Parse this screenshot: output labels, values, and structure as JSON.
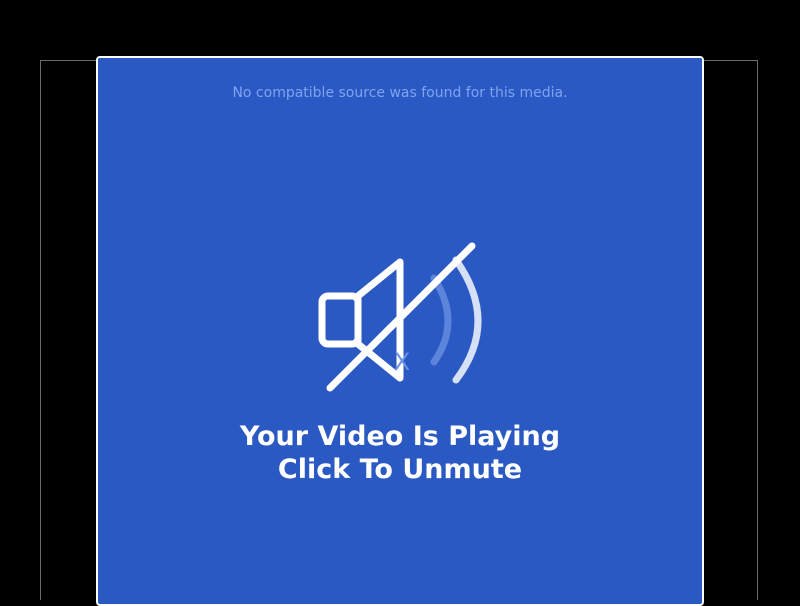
{
  "player": {
    "error_message": "No compatible source was found for this media.",
    "headline_line1": "Your Video Is Playing",
    "headline_line2": "Click To Unmute",
    "icon": "speaker-muted-icon",
    "icon_glyph": "X"
  },
  "colors": {
    "overlay_bg": "#2b59c3",
    "overlay_border": "#ffffff",
    "error_text": "#7fa3f0",
    "headline_text": "#ffffff",
    "page_bg": "#000000"
  }
}
